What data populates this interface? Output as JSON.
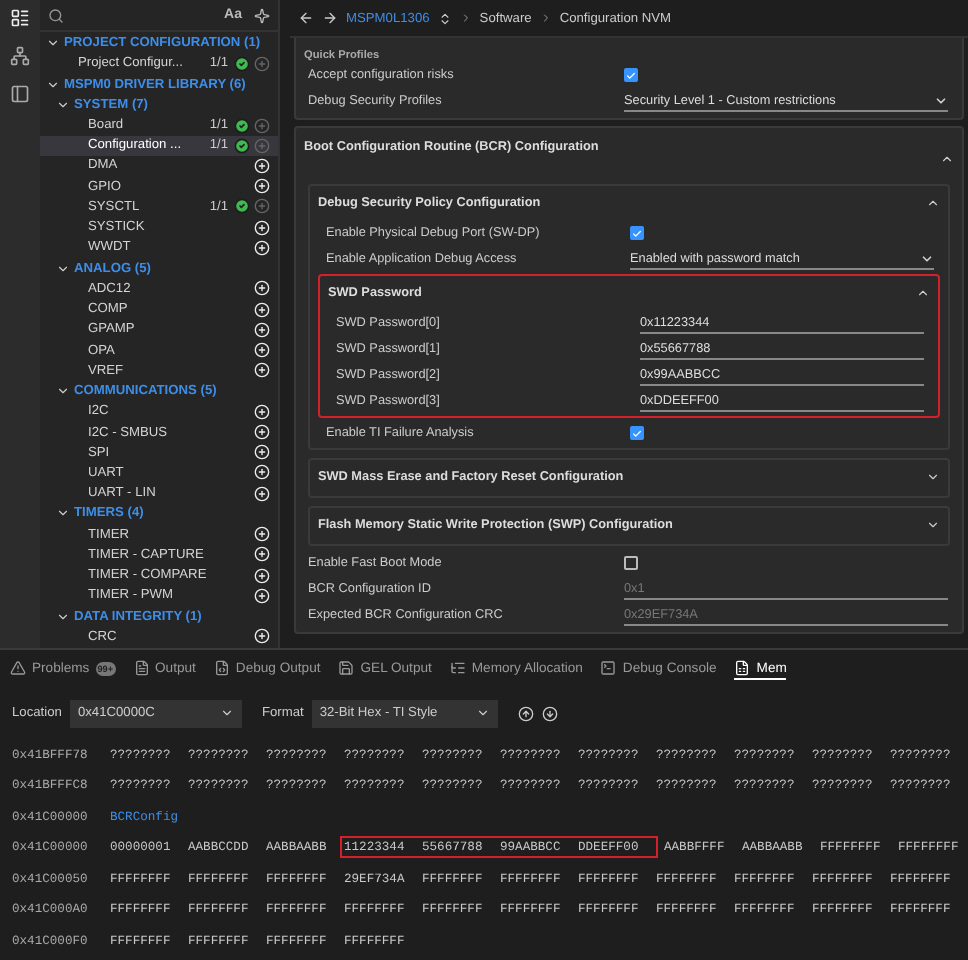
{
  "sidebar": {
    "case_button": "Aa",
    "tree": [
      {
        "label": "PROJECT CONFIGURATION (1)",
        "expanded": true,
        "children": [
          {
            "label": "Project Configur...",
            "count": "1/1",
            "configured": true,
            "selected": false
          }
        ]
      },
      {
        "label": "MSPM0 DRIVER LIBRARY (6)",
        "expanded": true,
        "children": [
          {
            "label": "SYSTEM (7)",
            "expanded": true,
            "children": [
              {
                "label": "Board",
                "count": "1/1",
                "configured": true,
                "selected": false
              },
              {
                "label": "Configuration ...",
                "count": "1/1",
                "configured": true,
                "selected": true
              },
              {
                "label": "DMA",
                "configured": false,
                "selected": false
              },
              {
                "label": "GPIO",
                "configured": false,
                "selected": false
              },
              {
                "label": "SYSCTL",
                "count": "1/1",
                "configured": true,
                "selected": false
              },
              {
                "label": "SYSTICK",
                "configured": false,
                "selected": false
              },
              {
                "label": "WWDT",
                "configured": false,
                "selected": false
              }
            ]
          },
          {
            "label": "ANALOG (5)",
            "expanded": true,
            "children": [
              {
                "label": "ADC12",
                "configured": false,
                "selected": false
              },
              {
                "label": "COMP",
                "configured": false,
                "selected": false
              },
              {
                "label": "GPAMP",
                "configured": false,
                "selected": false
              },
              {
                "label": "OPA",
                "configured": false,
                "selected": false
              },
              {
                "label": "VREF",
                "configured": false,
                "selected": false
              }
            ]
          },
          {
            "label": "COMMUNICATIONS (5)",
            "expanded": true,
            "children": [
              {
                "label": "I2C",
                "configured": false,
                "selected": false
              },
              {
                "label": "I2C - SMBUS",
                "configured": false,
                "selected": false
              },
              {
                "label": "SPI",
                "configured": false,
                "selected": false
              },
              {
                "label": "UART",
                "configured": false,
                "selected": false
              },
              {
                "label": "UART - LIN",
                "configured": false,
                "selected": false
              }
            ]
          },
          {
            "label": "TIMERS (4)",
            "expanded": true,
            "children": [
              {
                "label": "TIMER",
                "configured": false,
                "selected": false
              },
              {
                "label": "TIMER - CAPTURE",
                "configured": false,
                "selected": false
              },
              {
                "label": "TIMER - COMPARE",
                "configured": false,
                "selected": false
              },
              {
                "label": "TIMER - PWM",
                "configured": false,
                "selected": false
              }
            ]
          },
          {
            "label": "DATA INTEGRITY (1)",
            "expanded": true,
            "children": [
              {
                "label": "CRC",
                "configured": false,
                "selected": false
              }
            ]
          }
        ]
      }
    ]
  },
  "breadcrumb": {
    "device": "MSPM0L1306",
    "path": [
      "Software",
      "Configuration NVM"
    ]
  },
  "sections": [
    {
      "title": "Quick Profiles",
      "items": [
        {
          "kind": "checkbox",
          "label": "Accept configuration risks",
          "checked": true
        },
        {
          "kind": "select",
          "label": "Debug Security Profiles",
          "value": "Security Level 1 - Custom restrictions"
        }
      ]
    },
    {
      "title": "Boot Configuration Routine (BCR) Configuration",
      "expanded": true,
      "items": [
        {
          "kind": "group",
          "title": "Debug Security Policy Configuration",
          "expanded": true,
          "highlighted": false,
          "items": [
            {
              "kind": "checkbox",
              "label": "Enable Physical Debug Port (SW-DP)",
              "checked": true
            },
            {
              "kind": "select",
              "label": "Enable Application Debug Access",
              "value": "Enabled with password match"
            },
            {
              "kind": "group",
              "title": "SWD Password",
              "expanded": true,
              "highlighted": true,
              "items": [
                {
                  "kind": "field",
                  "label": "SWD Password[0]",
                  "value": "0x11223344",
                  "disabled": false
                },
                {
                  "kind": "field",
                  "label": "SWD Password[1]",
                  "value": "0x55667788",
                  "disabled": false
                },
                {
                  "kind": "field",
                  "label": "SWD Password[2]",
                  "value": "0x99AABBCC",
                  "disabled": false
                },
                {
                  "kind": "field",
                  "label": "SWD Password[3]",
                  "value": "0xDDEEFF00",
                  "disabled": false
                }
              ]
            },
            {
              "kind": "checkbox",
              "label": "Enable TI Failure Analysis",
              "checked": true
            }
          ]
        },
        {
          "kind": "group",
          "title": "SWD Mass Erase and Factory Reset Configuration",
          "expanded": false,
          "highlighted": false
        },
        {
          "kind": "group",
          "title": "Flash Memory Static Write Protection (SWP) Configuration",
          "expanded": false,
          "highlighted": false
        },
        {
          "kind": "checkbox",
          "label": "Enable Fast Boot Mode",
          "checked": false
        },
        {
          "kind": "field",
          "label": "BCR Configuration ID",
          "value": "0x1",
          "disabled": true
        },
        {
          "kind": "field",
          "label": "Expected BCR Configuration CRC",
          "value": "0x29EF734A",
          "disabled": true
        }
      ]
    }
  ],
  "panel": {
    "tabs": [
      {
        "label": "Problems",
        "badge": "99+",
        "selected": false
      },
      {
        "label": "Output",
        "selected": false
      },
      {
        "label": "Debug Output",
        "selected": false
      },
      {
        "label": "GEL Output",
        "selected": false
      },
      {
        "label": "Memory Allocation",
        "selected": false
      },
      {
        "label": "Debug Console",
        "selected": false
      },
      {
        "label": "Mem",
        "selected": true
      }
    ],
    "location": {
      "label": "Location",
      "value": "0x41C0000C"
    },
    "format": {
      "label": "Format",
      "value": "32-Bit Hex - TI Style"
    },
    "rows": [
      {
        "kind": "data",
        "address": "0x41BFFF78",
        "values": [
          "????????",
          "????????",
          "????????",
          "????????",
          "????????",
          "????????",
          "????????",
          "????????",
          "????????",
          "????????",
          "????????"
        ]
      },
      {
        "kind": "data",
        "address": "0x41BFFFC8",
        "values": [
          "????????",
          "????????",
          "????????",
          "????????",
          "????????",
          "????????",
          "????????",
          "????????",
          "????????",
          "????????",
          "????????"
        ]
      },
      {
        "kind": "label",
        "address": "0x41C00000",
        "label": "BCRConfig"
      },
      {
        "kind": "data",
        "address": "0x41C00000",
        "values": [
          "00000001",
          "AABBCCDD",
          "AABBAABB"
        ],
        "highlighted_values": [
          "11223344",
          "55667788",
          "99AABBCC",
          "DDEEFF00"
        ],
        "values_after": [
          "AABBFFFF",
          "AABBAABB",
          "FFFFFFFF",
          "FFFFFFFF"
        ]
      },
      {
        "kind": "data",
        "address": "0x41C00050",
        "values": [
          "FFFFFFFF",
          "FFFFFFFF",
          "FFFFFFFF",
          "29EF734A",
          "FFFFFFFF",
          "FFFFFFFF",
          "FFFFFFFF",
          "FFFFFFFF",
          "FFFFFFFF",
          "FFFFFFFF",
          "FFFFFFFF"
        ]
      },
      {
        "kind": "data",
        "address": "0x41C000A0",
        "values": [
          "FFFFFFFF",
          "FFFFFFFF",
          "FFFFFFFF",
          "FFFFFFFF",
          "FFFFFFFF",
          "FFFFFFFF",
          "FFFFFFFF",
          "FFFFFFFF",
          "FFFFFFFF",
          "FFFFFFFF",
          "FFFFFFFF"
        ]
      },
      {
        "kind": "data",
        "address": "0x41C000F0",
        "values": [
          "FFFFFFFF",
          "FFFFFFFF",
          "FFFFFFFF",
          "FFFFFFFF"
        ]
      }
    ]
  }
}
